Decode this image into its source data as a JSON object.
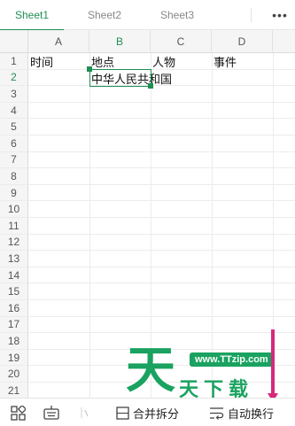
{
  "sheet_tabs": [
    {
      "label": "Sheet1",
      "active": true
    },
    {
      "label": "Sheet2",
      "active": false
    },
    {
      "label": "Sheet3",
      "active": false
    }
  ],
  "more_icon": "more-horizontal-icon",
  "more_glyph": "•••",
  "columns": [
    "A",
    "B",
    "C",
    "D"
  ],
  "active_column": "B",
  "rows": [
    "1",
    "2",
    "3",
    "4",
    "5",
    "6",
    "7",
    "8",
    "9",
    "10",
    "11",
    "12",
    "13",
    "14",
    "15",
    "16",
    "17",
    "18",
    "19",
    "20",
    "21"
  ],
  "active_row": "2",
  "cells": {
    "A1": "时间",
    "B1": "地点",
    "C1": "人物",
    "D1": "事件",
    "B2": "中华人民共和国"
  },
  "selected_cell": "B2",
  "watermark": {
    "url": "www.TTzip.com",
    "big_char": "天",
    "text": "天下载"
  },
  "toolbar": {
    "merge_split_label": "合并拆分",
    "auto_wrap_label": "自动换行",
    "icons": [
      "apps-icon",
      "keyboard-icon",
      "fill-icon",
      "merge-icon",
      "wrap-text-icon"
    ]
  },
  "colors": {
    "accent": "#1f8f55",
    "watermark": "#1aa260",
    "scroll_marker": "#d6297a"
  }
}
